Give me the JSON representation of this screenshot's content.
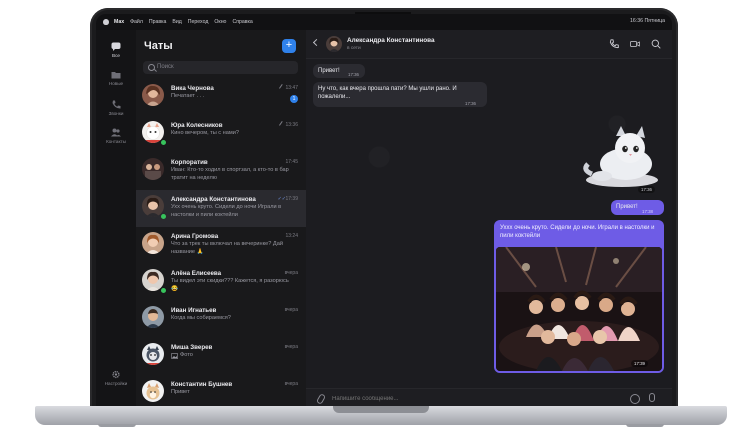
{
  "menubar": {
    "items": [
      "Max",
      "Файл",
      "Правка",
      "Вид",
      "Переход",
      "Окно",
      "Справка"
    ],
    "right": "16:36 Пятница"
  },
  "rail": {
    "all": "Все",
    "new": "Новые",
    "calls": "Звонки",
    "contacts": "Контакты",
    "settings": "Настройки"
  },
  "chatlist": {
    "title": "Чаты",
    "compose": "+",
    "search_placeholder": "Поиск",
    "items": [
      {
        "name": "Вика Чернова",
        "time": "13:47",
        "msg": "Печатает . . .",
        "badge": "1",
        "pinned": true
      },
      {
        "name": "Юра Колесников",
        "time": "13:36",
        "msg": "Кино вечером, ты с нами?",
        "pinned": true
      },
      {
        "name": "Корпоратив",
        "time": "17:45",
        "msg": "Иван: Кто-то ходил в спортзал, а кто-то в бар тратит на неделю"
      },
      {
        "name": "Александра Константинова",
        "time": "17:39",
        "msg": "Ухх очень круто. Сидели до ночи Играли в настолки и пили коктейли"
      },
      {
        "name": "Арина Громова",
        "time": "13:24",
        "msg": "Что за трек ты включал на вечеринке? Дай название 🙏"
      },
      {
        "name": "Алёна Елисеева",
        "time": "вчера",
        "msg": "Ты видел эти скидки??? Кажется, я разорюсь 😂"
      },
      {
        "name": "Иван Игнатьев",
        "time": "вчера",
        "msg": "Когда мы собираемся?"
      },
      {
        "name": "Миша Зверев",
        "time": "вчера",
        "msg": "Фото"
      },
      {
        "name": "Константин Бушнев",
        "time": "вчера",
        "msg": "Привет"
      }
    ]
  },
  "chat": {
    "name": "Александра Константинова",
    "status": "в сети",
    "messages": {
      "m1": {
        "text": "Привет!",
        "time": "17:36"
      },
      "m2": {
        "text": "Ну что, как вчера прошла пати? Мы ушли рано. И пожалели...",
        "time": "17:36"
      },
      "sticker_time": "17:36",
      "m3": {
        "text": "Привет!",
        "time": "17:38"
      },
      "m4": {
        "text": "Уххх очень круто. Сидели до ночи. Играли в настолки и пили коктейли",
        "time": "17:39"
      }
    },
    "composer_placeholder": "Напишите сообщение..."
  },
  "colors": {
    "accent": "#2f81ea",
    "outgoing_bubble": "#6e5ce6",
    "incoming_bubble": "#2b2b31",
    "online": "#37c35c"
  }
}
